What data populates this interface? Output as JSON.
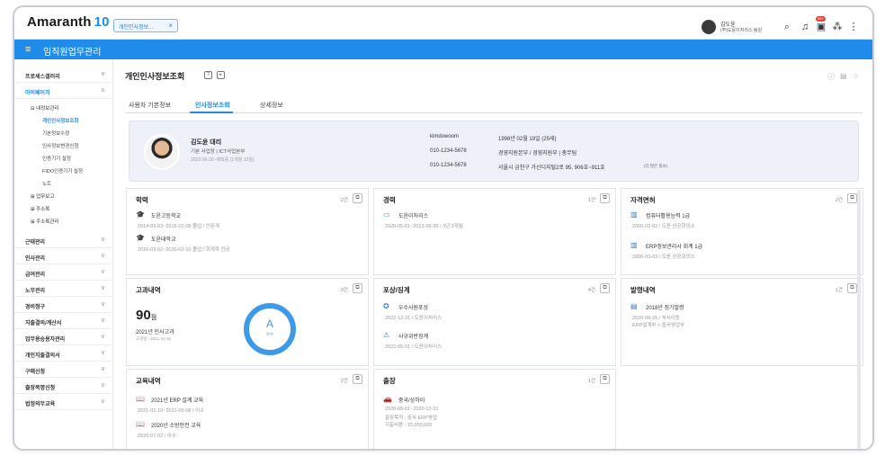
{
  "header": {
    "logo_text": "Amaranth",
    "logo_num": "10",
    "open_tab": "개인인사정보...",
    "user_name": "김도윤",
    "user_company": "(주)도윤이처리스 팀원",
    "notif_count": "99+"
  },
  "module": {
    "title": "임직원업무관리"
  },
  "sidebar": {
    "items": [
      {
        "label": "프로세스갤러리"
      },
      {
        "label": "마이페이지"
      },
      {
        "label": "근태관리"
      },
      {
        "label": "인사관리"
      },
      {
        "label": "급여관리"
      },
      {
        "label": "노무관리"
      },
      {
        "label": "경비청구"
      },
      {
        "label": "지출결의/계산서"
      },
      {
        "label": "업무용승용차관리"
      },
      {
        "label": "개인지출결의서"
      },
      {
        "label": "구매신청"
      },
      {
        "label": "출장복명신청"
      },
      {
        "label": "법정의무교육"
      }
    ],
    "group_info": "내정보관리",
    "sub_items": [
      "개인인사정보조회",
      "기본정보수정",
      "인사정보변경신청",
      "인증기기 설정",
      "FIDO인증기기 설정",
      "노트"
    ],
    "groups": [
      "업무보고",
      "주소록",
      "주소록관리"
    ]
  },
  "page": {
    "title": "개인인사정보조회"
  },
  "tabs": [
    "사용자 기본정보",
    "인사정보조회",
    "상세정보"
  ],
  "profile": {
    "name": "김도윤 대리",
    "dept": "기본 사업장 | ICT사업본부",
    "joined": "2023-06-20~재직중 (1개월 10일)",
    "id": "kimdowoom",
    "phone1": "010-1234-5678",
    "phone2": "010-1234-5678",
    "birth": "1998년 02월 19일 (25세)",
    "org": "경영지원본부 / 경영지원부 | 총무팀",
    "address": "서울시 금천구 가산디지털2로 95, 906호~911호",
    "extra": "(더 많은 정보)"
  },
  "cards": {
    "education": {
      "title": "학력",
      "count": "2건",
      "entries": [
        {
          "name": "도윤고등학교",
          "detail": "2014-03-03~2016-02-08 졸업 / 인문계"
        },
        {
          "name": "도윤대학교",
          "detail": "2016-03-02~2020-02-10 졸업 / 회계학 전공"
        }
      ]
    },
    "career": {
      "title": "경력",
      "count": "1건",
      "entries": [
        {
          "name": "도윤이처리스",
          "detail": "2020-05-01~2023-06-30 / 3년 2개월"
        }
      ]
    },
    "license": {
      "title": "자격면허",
      "count": "2건",
      "entries": [
        {
          "name": "컴퓨터활용능력 1급",
          "detail": "2000-02-02 / 도윤 상공회의소"
        },
        {
          "name": "ERP정보관리사 회계 1급",
          "detail": "2000-03-03 / 도윤 상공회의소"
        }
      ]
    },
    "evaluation": {
      "title": "고과내역",
      "count": "3건",
      "score": "90",
      "score_unit": "점",
      "period": "2021년 인사고과",
      "range": "고과일 : 2021-12-31",
      "grade": "A",
      "grade_label": "우수"
    },
    "reward": {
      "title": "포상/징계",
      "count": "4건",
      "entries": [
        {
          "name": "우수사원포상",
          "detail": "2022-12-31 / 도윤이처리스"
        },
        {
          "name": "사규위반징계",
          "detail": "2022-05-01 / 도윤이처리스"
        }
      ]
    },
    "appointment": {
      "title": "발령내역",
      "count": "1건",
      "entries": [
        {
          "name": "2018년 정기발령",
          "detail": "2020-08-25 / 부서이동",
          "detail2": "ERP설계부 > 중국영업부"
        }
      ]
    },
    "training": {
      "title": "교육내역",
      "count": "2건",
      "entries": [
        {
          "name": "2021년 ERP 설계 교육",
          "detail": "2021-02-10~2021-05-08 / 이수"
        },
        {
          "name": "2020년 소방안전 교육",
          "detail": "2020-07-02 / 이수"
        }
      ]
    },
    "trip": {
      "title": "출장",
      "count": "1건",
      "entries": [
        {
          "name": "중국/상하이",
          "detail": "2020-08-01~2020-12-31",
          "detail2": "출장목적 : 중국 ERP영업",
          "detail3": "지출비용 : 15,000,000"
        }
      ]
    }
  },
  "colors": {
    "accent": "#1f8bea",
    "ring": "#3d9ae8"
  },
  "icons": [
    "menu-icon",
    "search-icon",
    "bell-icon",
    "calendar-icon",
    "org-icon",
    "more-icon",
    "copy-icon",
    "graduation-icon",
    "briefcase-icon",
    "certificate-icon",
    "award-icon",
    "book-icon",
    "car-icon"
  ]
}
